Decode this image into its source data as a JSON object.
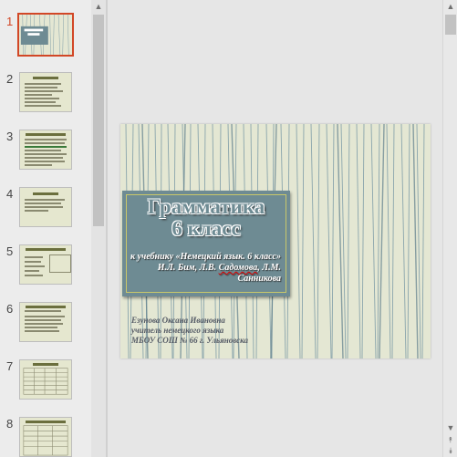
{
  "thumbnails": [
    {
      "number": "1",
      "selected": true
    },
    {
      "number": "2",
      "selected": false
    },
    {
      "number": "3",
      "selected": false
    },
    {
      "number": "4",
      "selected": false
    },
    {
      "number": "5",
      "selected": false
    },
    {
      "number": "6",
      "selected": false
    },
    {
      "number": "7",
      "selected": false
    },
    {
      "number": "8",
      "selected": false
    }
  ],
  "slide": {
    "title_line1": "Грамматика",
    "title_line2": "6 класс",
    "subtitle_part1": "к учебнику «Немецкий язык. 6 класс» И.Л. Бим, Л.В. ",
    "subtitle_squiggle": "Садомова",
    "subtitle_part2": ", Л.М. Санникова",
    "author_line1": "Езунова Оксана Ивановна",
    "author_line2": "учитель немецкого языка",
    "author_line3": "МБОУ СОШ № 66 г. Ульяновска"
  },
  "colors": {
    "accent": "#d24726",
    "slide_bg": "#e4e7d3",
    "title_box": "#6e8b93",
    "stripe": "#7b9aa6"
  },
  "icons": {
    "scroll_up": "▲",
    "scroll_down": "▼",
    "page_up": "⯭",
    "page_down": "⯯"
  }
}
